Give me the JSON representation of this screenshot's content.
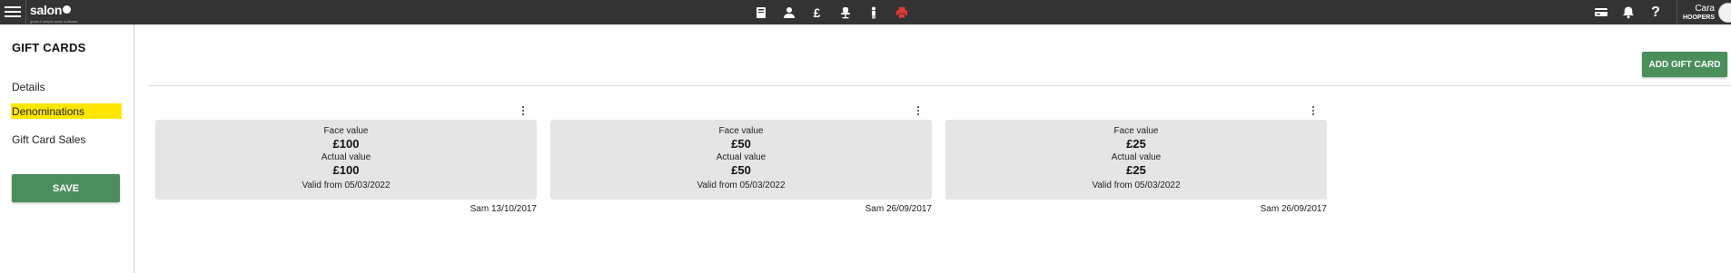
{
  "header": {
    "logo_text": "salon",
    "logo_tagline": "great & simple salon software",
    "center_icons": [
      "book-icon",
      "person-icon",
      "pound-icon",
      "chair-icon",
      "staff-icon",
      "printer-icon"
    ],
    "pound_glyph": "£",
    "help_glyph": "?",
    "user_name": "Cara",
    "salon_name": "HOOPERS"
  },
  "sidebar": {
    "title": "GIFT CARDS",
    "items": [
      {
        "label": "Details"
      },
      {
        "label": "Denominations"
      },
      {
        "label": "Gift Card Sales"
      }
    ],
    "save_label": "SAVE"
  },
  "main": {
    "add_label": "ADD GIFT CARD",
    "cards": [
      {
        "face_label": "Face value",
        "face_value": "£100",
        "actual_label": "Actual value",
        "actual_value": "£100",
        "valid": "Valid from 05/03/2022",
        "footer": "Sam 13/10/2017"
      },
      {
        "face_label": "Face value",
        "face_value": "£50",
        "actual_label": "Actual value",
        "actual_value": "£50",
        "valid": "Valid from 05/03/2022",
        "footer": "Sam 26/09/2017"
      },
      {
        "face_label": "Face value",
        "face_value": "£25",
        "actual_label": "Actual value",
        "actual_value": "£25",
        "valid": "Valid from 05/03/2022",
        "footer": "Sam 26/09/2017"
      }
    ]
  },
  "colors": {
    "topbar": "#333333",
    "accent_green": "#4a8e5c",
    "active_highlight": "#ffe600",
    "printer_red": "#e53935",
    "card_bg": "#e5e5e5"
  }
}
